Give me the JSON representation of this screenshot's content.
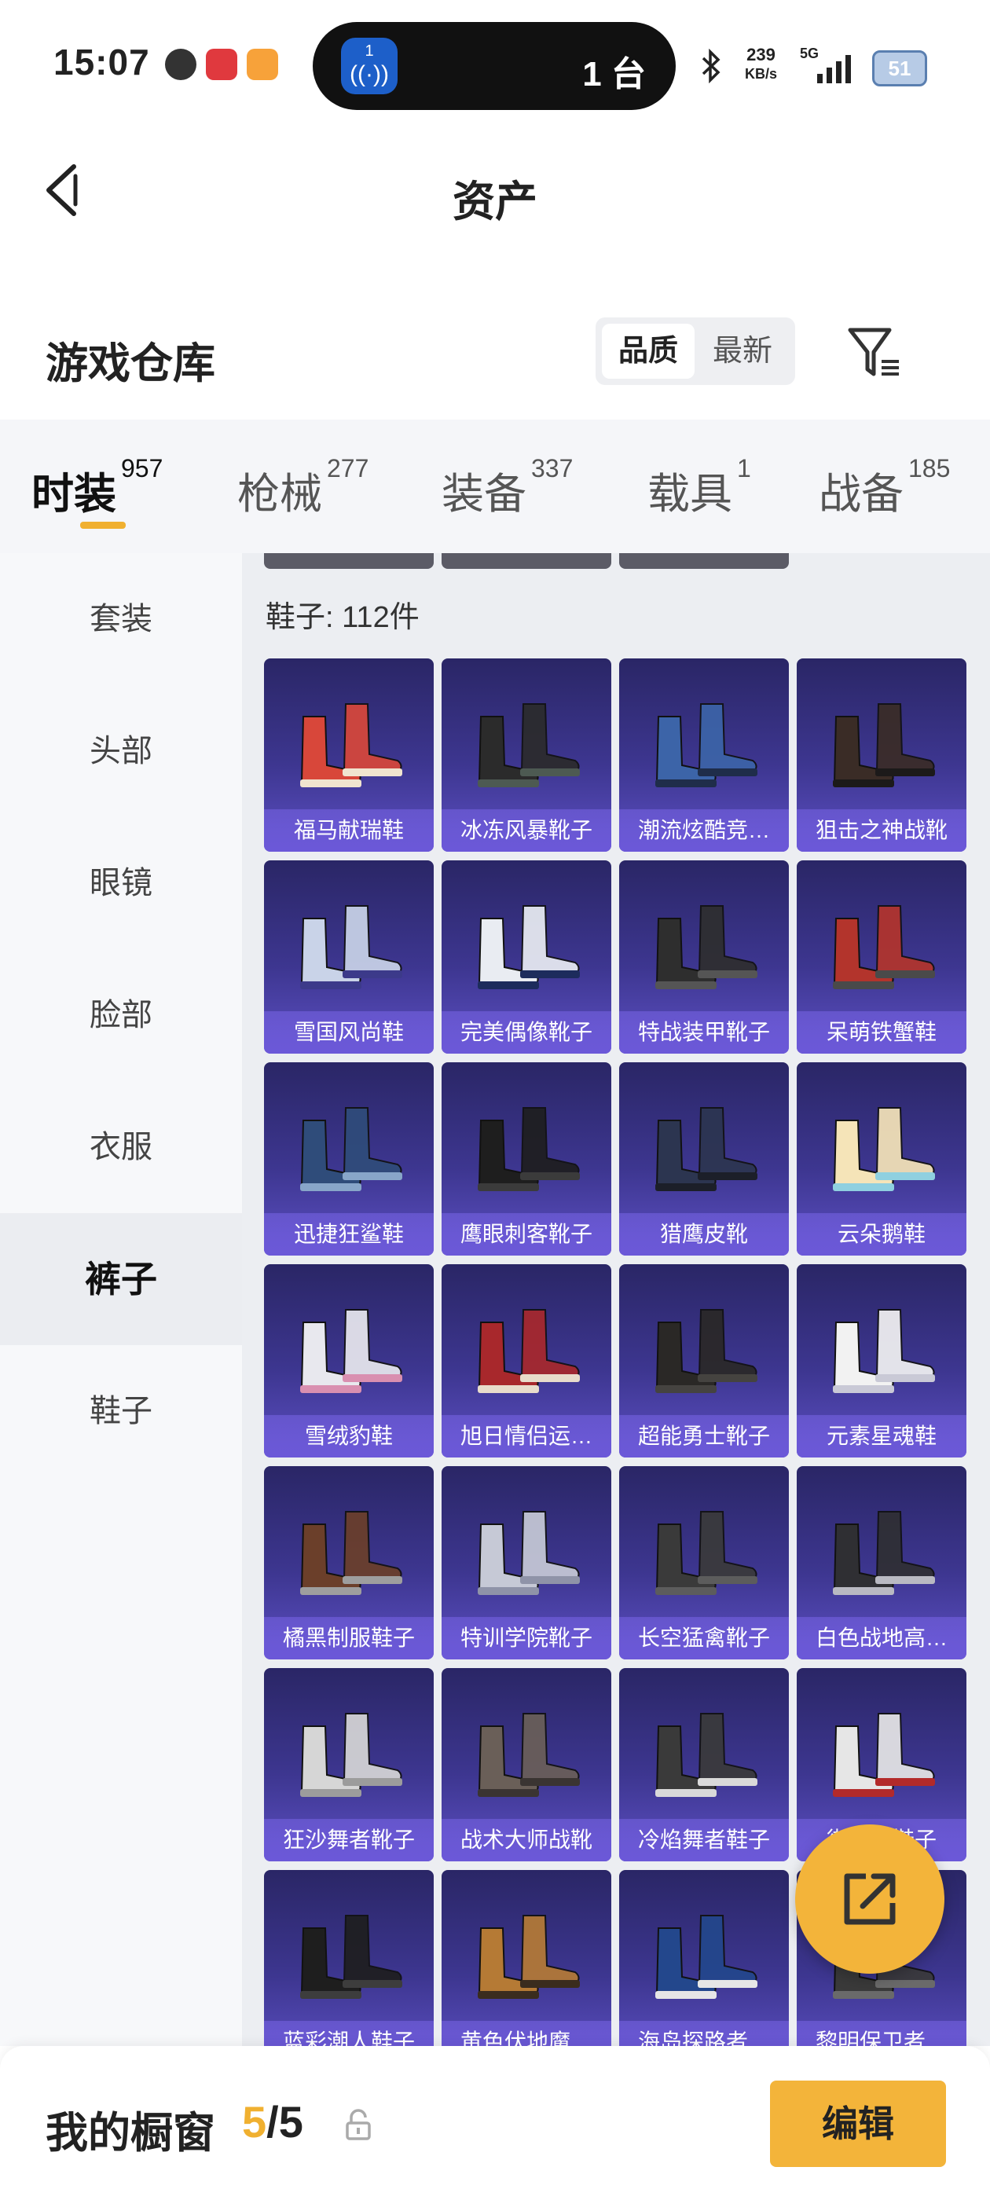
{
  "status_bar": {
    "time": "15:07",
    "live_count": "1 台",
    "live_badge": "1",
    "net_speed_value": "239",
    "net_speed_unit": "KB/s",
    "network": "5G",
    "battery": "51"
  },
  "header": {
    "title": "资产"
  },
  "warehouse": {
    "title": "游戏仓库",
    "sort_options": [
      "品质",
      "最新"
    ],
    "sort_active": "品质"
  },
  "tabs": [
    {
      "label": "时装",
      "count": "957",
      "active": true
    },
    {
      "label": "枪械",
      "count": "277"
    },
    {
      "label": "装备",
      "count": "337"
    },
    {
      "label": "载具",
      "count": "1"
    },
    {
      "label": "战备",
      "count": "185"
    }
  ],
  "sidebar": {
    "items": [
      {
        "label": "套装"
      },
      {
        "label": "头部"
      },
      {
        "label": "眼镜"
      },
      {
        "label": "脸部"
      },
      {
        "label": "衣服"
      },
      {
        "label": "裤子",
        "active": true
      },
      {
        "label": "鞋子"
      }
    ]
  },
  "section": {
    "heading": "鞋子: 112件"
  },
  "items": [
    {
      "name": "福马献瑞鞋",
      "colors": [
        "#d8473a",
        "#f0e4cf"
      ]
    },
    {
      "name": "冰冻风暴靴子",
      "colors": [
        "#2b2b2b",
        "#4d5a52"
      ]
    },
    {
      "name": "潮流炫酷竞…",
      "colors": [
        "#3c64a8",
        "#1f2d4a"
      ]
    },
    {
      "name": "狙击之神战靴",
      "colors": [
        "#3a2c26",
        "#1c1a1a"
      ]
    },
    {
      "name": "雪国风尚鞋",
      "colors": [
        "#c9d3e8",
        "#3c3a8a"
      ]
    },
    {
      "name": "完美偶像靴子",
      "colors": [
        "#e9ecf2",
        "#1d2c5c"
      ]
    },
    {
      "name": "特战装甲靴子",
      "colors": [
        "#2e2e2e",
        "#555555"
      ]
    },
    {
      "name": "呆萌铁蟹鞋",
      "colors": [
        "#b3342c",
        "#4a4a4a"
      ]
    },
    {
      "name": "迅捷狂鲨鞋",
      "colors": [
        "#2f4c7a",
        "#88a6c9"
      ]
    },
    {
      "name": "鹰眼刺客靴子",
      "colors": [
        "#1e1e1e",
        "#3b3b3b"
      ]
    },
    {
      "name": "猎鹰皮靴",
      "colors": [
        "#2c3550",
        "#1c1f29"
      ]
    },
    {
      "name": "云朵鹅鞋",
      "colors": [
        "#f5e4b8",
        "#8fd0e0"
      ]
    },
    {
      "name": "雪绒豹鞋",
      "colors": [
        "#e8e8ee",
        "#d98fb0"
      ]
    },
    {
      "name": "旭日情侣运…",
      "colors": [
        "#a8282c",
        "#e8dccb"
      ]
    },
    {
      "name": "超能勇士靴子",
      "colors": [
        "#2a2826",
        "#454340"
      ]
    },
    {
      "name": "元素星魂鞋",
      "colors": [
        "#f2f2f2",
        "#c9c9d6"
      ]
    },
    {
      "name": "橘黑制服鞋子",
      "colors": [
        "#6b3f2a",
        "#9e9e9e"
      ]
    },
    {
      "name": "特训学院靴子",
      "colors": [
        "#c6c9d6",
        "#8f93a8"
      ]
    },
    {
      "name": "长空猛禽靴子",
      "colors": [
        "#3a3a3a",
        "#5c5c5c"
      ]
    },
    {
      "name": "白色战地高…",
      "colors": [
        "#2f2f33",
        "#b9b9c2"
      ]
    },
    {
      "name": "狂沙舞者靴子",
      "colors": [
        "#d6d6d6",
        "#9c9c9c"
      ]
    },
    {
      "name": "战术大师战靴",
      "colors": [
        "#6a5f58",
        "#3a3432"
      ]
    },
    {
      "name": "冷焰舞者鞋子",
      "colors": [
        "#3a3a3a",
        "#d9d9d9"
      ]
    },
    {
      "name": "街头…鞋子",
      "colors": [
        "#e6e6e6",
        "#b32a2a"
      ]
    },
    {
      "name": "蓝彩潮人鞋子",
      "colors": [
        "#1e1e1e",
        "#3d3d3d"
      ]
    },
    {
      "name": "黄色伏地魔…",
      "colors": [
        "#b57a35",
        "#3a2c1e"
      ]
    },
    {
      "name": "海岛探路者…",
      "colors": [
        "#23478c",
        "#e6e6e6"
      ]
    },
    {
      "name": "黎明保卫者…",
      "colors": [
        "#3a3a3a",
        "#6a6a6a"
      ]
    }
  ],
  "bottom_bar": {
    "title": "我的橱窗",
    "count_current": "5",
    "count_total": "/5",
    "edit_label": "编辑"
  },
  "accent_color": "#f3b43a",
  "icons": [
    "back-arrow-icon",
    "filter-icon",
    "share-icon",
    "lock-icon",
    "bluetooth-icon",
    "signal-icon",
    "battery-icon"
  ]
}
